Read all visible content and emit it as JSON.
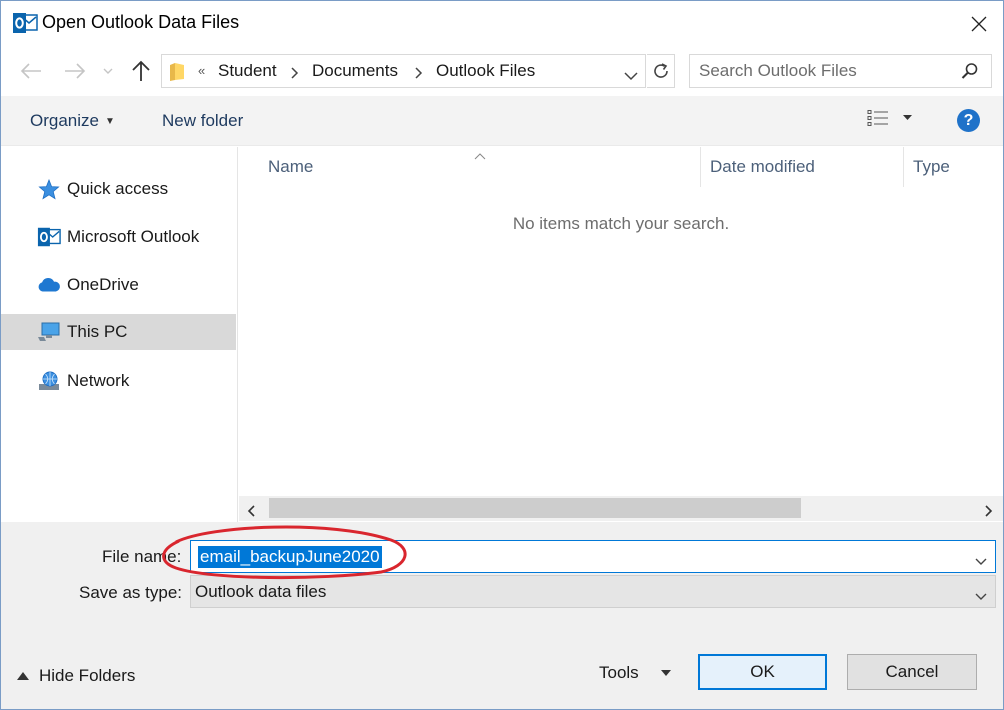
{
  "window": {
    "title": "Open Outlook Data Files",
    "icon": "outlook-icon"
  },
  "address": {
    "overflow": "«",
    "crumbs": [
      "Student",
      "Documents",
      "Outlook Files"
    ]
  },
  "search": {
    "placeholder": "Search Outlook Files"
  },
  "toolbar": {
    "organize_label": "Organize",
    "new_folder_label": "New folder",
    "help_label": "?"
  },
  "nav_pane": {
    "items": [
      {
        "label": "Quick access",
        "icon": "star-icon"
      },
      {
        "label": "Microsoft Outlook",
        "icon": "outlook-icon"
      },
      {
        "label": "OneDrive",
        "icon": "cloud-icon"
      },
      {
        "label": "This PC",
        "icon": "computer-icon",
        "selected": true
      },
      {
        "label": "Network",
        "icon": "network-icon"
      }
    ]
  },
  "file_list": {
    "columns": [
      "Name",
      "Date modified",
      "Type"
    ],
    "empty_message": "No items match your search."
  },
  "bottom": {
    "file_name_label": "File name:",
    "file_name_value": "email_backupJune2020",
    "save_type_label": "Save as type:",
    "save_type_value": "Outlook data files",
    "hide_folders_label": "Hide Folders",
    "tools_label": "Tools",
    "ok_label": "OK",
    "cancel_label": "Cancel"
  },
  "colors": {
    "accent": "#0078d7",
    "annotation": "#d9262e",
    "toolbar_bg": "#f3f3f3",
    "selected_bg": "#d9d9d9"
  }
}
